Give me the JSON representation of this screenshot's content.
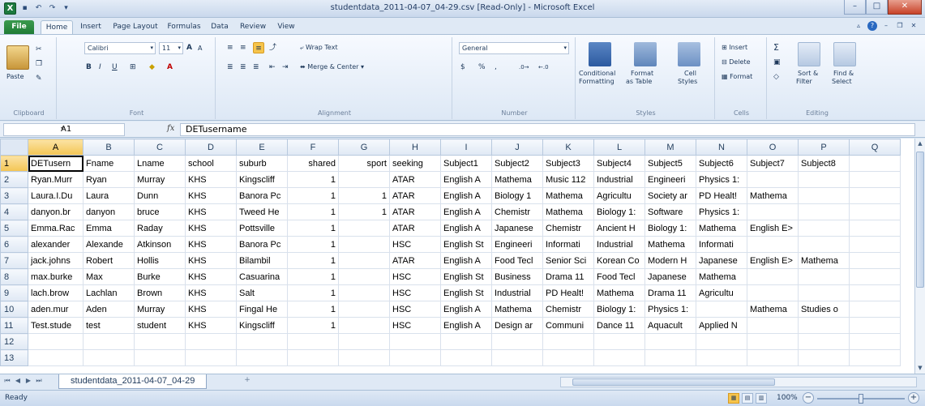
{
  "window": {
    "title": "studentdata_2011-04-07_04-29.csv  [Read-Only] - Microsoft Excel",
    "app_icon": "X",
    "qat": [
      "save-icon",
      "undo-icon",
      "redo-icon",
      "customize-icon"
    ],
    "controls": {
      "minimize": "–",
      "maximize": "□",
      "close": "✕"
    }
  },
  "tabs": [
    "File",
    "Home",
    "Insert",
    "Page Layout",
    "Formulas",
    "Data",
    "Review",
    "View"
  ],
  "active_tab": "Home",
  "ribbon": {
    "clipboard": {
      "paste": "Paste",
      "label": "Clipboard"
    },
    "font": {
      "name": "Calibri",
      "size": "11",
      "bold": "B",
      "italic": "I",
      "underline": "U",
      "grow": "A",
      "shrink": "A",
      "label": "Font"
    },
    "alignment": {
      "wrap": "Wrap Text",
      "merge": "Merge & Center",
      "label": "Alignment"
    },
    "number": {
      "format": "General",
      "currency": "$",
      "percent": "%",
      "comma": ",",
      "label": "Number"
    },
    "styles": {
      "conditional": "Conditional",
      "conditional2": "Formatting",
      "format": "Format",
      "format2": "as Table",
      "cell": "Cell",
      "cell2": "Styles",
      "label": "Styles"
    },
    "cells": {
      "insert": "Insert",
      "delete": "Delete",
      "format": "Format",
      "label": "Cells"
    },
    "editing": {
      "sort": "Sort &",
      "sort2": "Filter",
      "find": "Find &",
      "find2": "Select",
      "label": "Editing"
    }
  },
  "formula_bar": {
    "name_box": "A1",
    "fx": "fx",
    "value": "DETusername"
  },
  "grid": {
    "columns": [
      "A",
      "B",
      "C",
      "D",
      "E",
      "F",
      "G",
      "H",
      "I",
      "J",
      "K",
      "L",
      "M",
      "N",
      "O",
      "P",
      "Q"
    ],
    "rows": [
      [
        "DETusern",
        "Fname",
        "Lname",
        "school",
        "suburb",
        "shared",
        "sport",
        "seeking",
        "Subject1",
        "Subject2",
        "Subject3",
        "Subject4",
        "Subject5",
        "Subject6",
        "Subject7",
        "Subject8",
        ""
      ],
      [
        "Ryan.Murr",
        "Ryan",
        "Murray",
        "KHS",
        "Kingscliff",
        "1",
        "",
        "ATAR",
        "English A",
        "Mathema",
        "Music 112",
        "Industrial",
        "Engineeri",
        "Physics 1:",
        "",
        "",
        ""
      ],
      [
        "Laura.I.Du",
        "Laura",
        "Dunn",
        "KHS",
        "Banora Pc",
        "1",
        "1",
        "ATAR",
        "English A",
        "Biology 1",
        "Mathema",
        "Agricultu",
        "Society ar",
        "PD Healt!",
        "Mathema",
        "",
        ""
      ],
      [
        "danyon.br",
        "danyon",
        "bruce",
        "KHS",
        "Tweed He",
        "1",
        "1",
        "ATAR",
        "English A",
        "Chemistr",
        "Mathema",
        "Biology 1:",
        "Software",
        "Physics 1:",
        "",
        "",
        ""
      ],
      [
        "Emma.Rac",
        "Emma",
        "Raday",
        "KHS",
        "Pottsville",
        "1",
        "",
        "ATAR",
        "English A",
        "Japanese",
        "Chemistr",
        "Ancient H",
        "Biology 1:",
        "Mathema",
        "English E>",
        "",
        ""
      ],
      [
        "alexander",
        "Alexande",
        "Atkinson",
        "KHS",
        "Banora Pc",
        "1",
        "",
        "HSC",
        "English St",
        "Engineeri",
        "Informati",
        "Industrial",
        "Mathema",
        "Informati",
        "",
        "",
        ""
      ],
      [
        "jack.johns",
        "Robert",
        "Hollis",
        "KHS",
        "Bilambil",
        "1",
        "",
        "ATAR",
        "English A",
        "Food Tecl",
        "Senior Sci",
        "Korean Co",
        "Modern H",
        "Japanese",
        "English E>",
        "Mathema",
        ""
      ],
      [
        "max.burke",
        "Max",
        "Burke",
        "KHS",
        "Casuarina",
        "1",
        "",
        "HSC",
        "English St",
        "Business",
        "Drama 11",
        "Food Tecl",
        "Japanese",
        "Mathema",
        "",
        "",
        ""
      ],
      [
        "lach.brow",
        "Lachlan",
        "Brown",
        "KHS",
        "Salt",
        "1",
        "",
        "HSC",
        "English St",
        "Industrial",
        "PD Healt!",
        "Mathema",
        "Drama 11",
        "Agricultu",
        "",
        "",
        ""
      ],
      [
        "aden.mur",
        "Aden",
        "Murray",
        "KHS",
        "Fingal He",
        "1",
        "",
        "HSC",
        "English A",
        "Mathema",
        "Chemistr",
        "Biology 1:",
        "Physics 1:",
        "",
        "Mathema",
        "Studies o",
        ""
      ],
      [
        "Test.stude",
        "test",
        "student",
        "KHS",
        "Kingscliff",
        "1",
        "",
        "HSC",
        "English A",
        "Design ar",
        "Communi",
        "Dance 11",
        "Aquacult",
        "Applied N",
        "",
        "",
        ""
      ],
      [
        "",
        "",
        "",
        "",
        "",
        "",
        "",
        "",
        "",
        "",
        "",
        "",
        "",
        "",
        "",
        "",
        ""
      ],
      [
        "",
        "",
        "",
        "",
        "",
        "",
        "",
        "",
        "",
        "",
        "",
        "",
        "",
        "",
        "",
        "",
        ""
      ]
    ],
    "numeric_columns": [
      5,
      6
    ]
  },
  "sheet_tabs": {
    "nav": [
      "⏮",
      "◀",
      "▶",
      "⏭"
    ],
    "active": "studentdata_2011-04-07_04-29",
    "new_sheet": "+"
  },
  "status": {
    "text": "Ready",
    "zoom": "100%",
    "zoom_level": 0.5,
    "zoom_minus": "−",
    "zoom_plus": "+"
  }
}
